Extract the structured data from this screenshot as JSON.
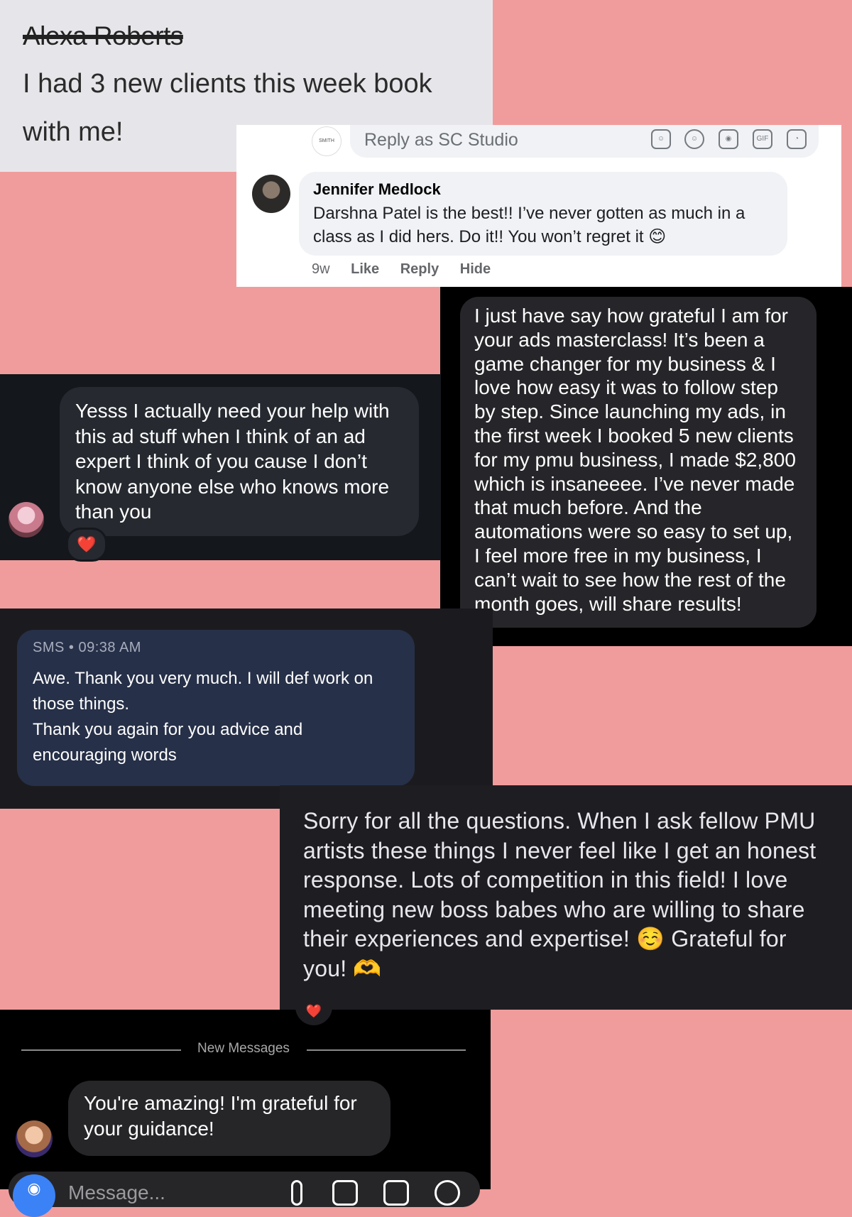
{
  "card1": {
    "author": "Alexa Roberts",
    "message": "I had 3 new clients this week book with me!"
  },
  "card2": {
    "page_logo_text": "SMITH",
    "reply_placeholder": "Reply as SC Studio",
    "tool_icons": [
      "avatar-sticker-icon",
      "smiley-icon",
      "camera-icon",
      "gif-icon",
      "sticker-icon"
    ],
    "commenter_name": "Jennifer Medlock",
    "comment_text": "Darshna Patel is the best!! I’ve never gotten as much in a class as I did hers. Do it!! You won’t regret it 😊",
    "time": "9w",
    "like_label": "Like",
    "reply_label": "Reply",
    "hide_label": "Hide"
  },
  "card3": {
    "message": "I just have say how grateful I am for your ads masterclass! It’s been a game changer for my business & I love how easy it was to follow step by step. Since launching my ads, in the first week I booked 5 new clients for my pmu business, I made $2,800 which is insaneeee. I’ve never made that much before. And the automations were so easy to set up, I feel more free in my business, I can’t wait to see how the rest of the month goes, will share results!"
  },
  "card4": {
    "message": "Yesss I actually need your help with this ad stuff when I think of an ad expert I think of you cause I don’t know anyone else who knows more than you",
    "reaction": "❤️"
  },
  "card5": {
    "meta": "SMS • 09:38 AM",
    "message": "Awe. Thank you very much. I will def work on those things.\nThank you again for you advice and encouraging words"
  },
  "card6": {
    "message": "Sorry for all the questions. When I ask fellow PMU artists these things I never feel like I get an honest response. Lots of competition in this field! I love meeting new boss babes who are willing to share their experiences and expertise! ☺️ Grateful for you! 🫶"
  },
  "card7": {
    "reaction": "❤️",
    "divider_label": "New Messages",
    "message": "You're amazing! I'm grateful for your guidance!",
    "composer_placeholder": "Message...",
    "composer_icons": [
      "camera-icon",
      "mic-icon",
      "image-icon",
      "sticker-icon",
      "add-icon"
    ]
  },
  "colors": {
    "background": "#f19c9c",
    "fb_bubble": "#f0f2f5",
    "imessage_bubble": "#26262a",
    "sms_bubble": "#263048",
    "camera_button": "#3b82f6",
    "heart": "#e8303f"
  }
}
